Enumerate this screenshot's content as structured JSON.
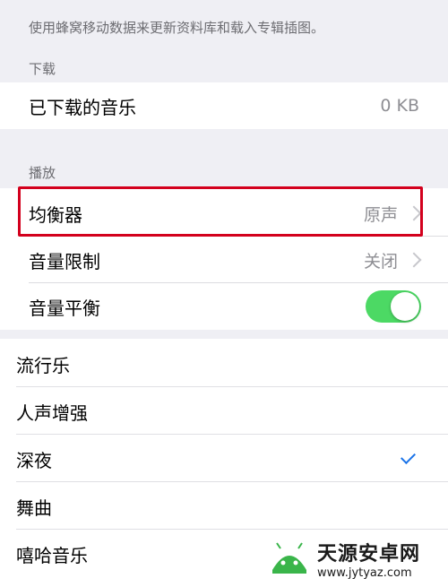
{
  "top_note": "使用蜂窝移动数据来更新资料库和载入专辑插图。",
  "download_section": {
    "header": "下载",
    "item_label": "已下载的音乐",
    "item_value": "0 KB"
  },
  "playback_section": {
    "header": "播放",
    "equalizer_label": "均衡器",
    "equalizer_value": "原声",
    "volume_limit_label": "音量限制",
    "volume_limit_value": "关闭",
    "sound_check_label": "音量平衡",
    "sound_check_on": true
  },
  "eq_list": [
    {
      "label": "流行乐",
      "checked": false
    },
    {
      "label": "人声增强",
      "checked": false
    },
    {
      "label": "深夜",
      "checked": true
    },
    {
      "label": "舞曲",
      "checked": false
    },
    {
      "label": "嘻哈音乐",
      "checked": false
    }
  ],
  "watermark": {
    "title": "天源安卓网",
    "url": "www.jytyaz.com"
  },
  "colors": {
    "highlight": "#d3001d",
    "toggle_on": "#4cd964",
    "checkmark": "#1a73e8"
  }
}
